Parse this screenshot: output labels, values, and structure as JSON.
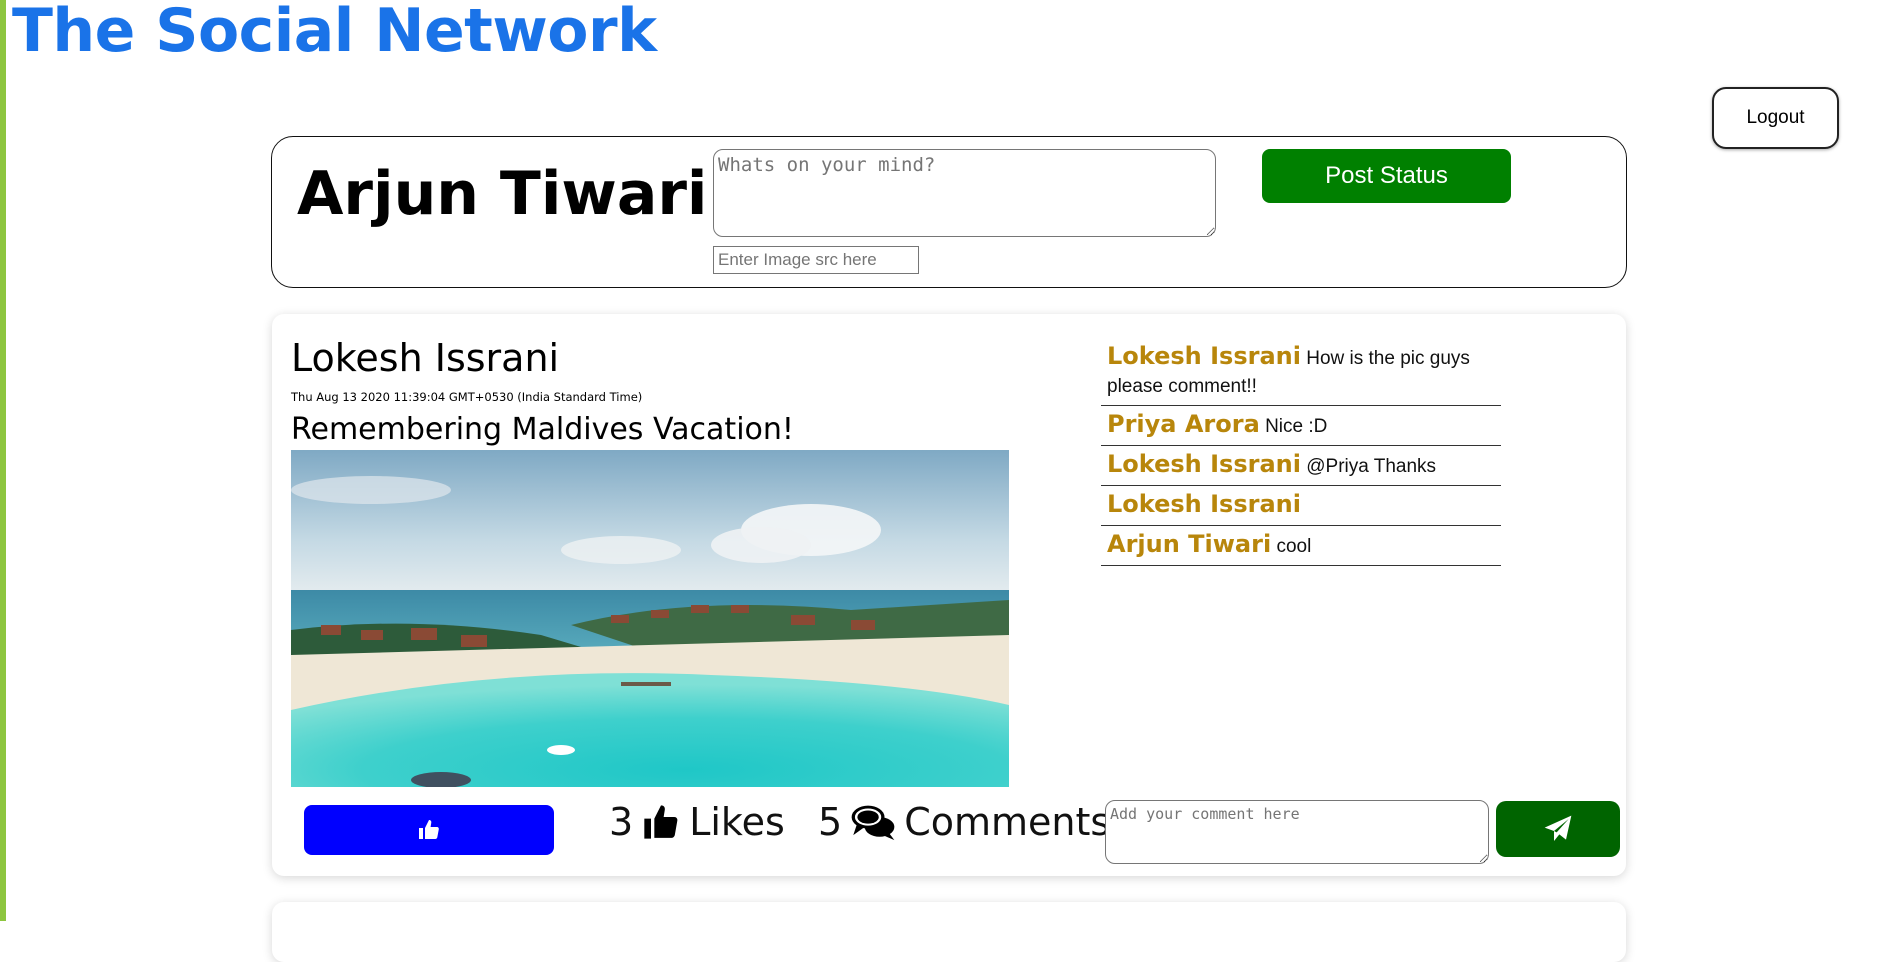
{
  "app": {
    "title": "The Social Network"
  },
  "header": {
    "logout_label": "Logout"
  },
  "composer": {
    "user_name": "Arjun Tiwari",
    "status_placeholder": "Whats on your mind?",
    "image_placeholder": "Enter Image src here",
    "post_label": "Post Status"
  },
  "post": {
    "author": "Lokesh Issrani",
    "timestamp": "Thu Aug 13 2020 11:39:04 GMT+0530 (India Standard Time)",
    "text": "Remembering Maldives Vacation!",
    "likes_count": "3",
    "likes_label": "Likes",
    "comments_count": "5",
    "comments_label": "Comments",
    "comment_placeholder": "Add your comment here",
    "comments": [
      {
        "author": "Lokesh Issrani",
        "text": "How is the pic guys please comment!!"
      },
      {
        "author": "Priya Arora",
        "text": "Nice :D"
      },
      {
        "author": "Lokesh Issrani",
        "text": "@Priya Thanks"
      },
      {
        "author": "Lokesh Issrani",
        "text": ""
      },
      {
        "author": "Arjun Tiwari",
        "text": "cool"
      }
    ]
  },
  "colors": {
    "title_blue": "#1a73e8",
    "post_green": "#008000",
    "like_blue": "#0000ff",
    "send_green": "#006400",
    "comment_author_gold": "#b8860b",
    "left_bar": "#8dc63f"
  },
  "icons": {
    "like_button": "thumbs-up-icon",
    "likes": "thumbs-up-icon",
    "comments": "comments-icon",
    "send": "paper-plane-icon"
  }
}
